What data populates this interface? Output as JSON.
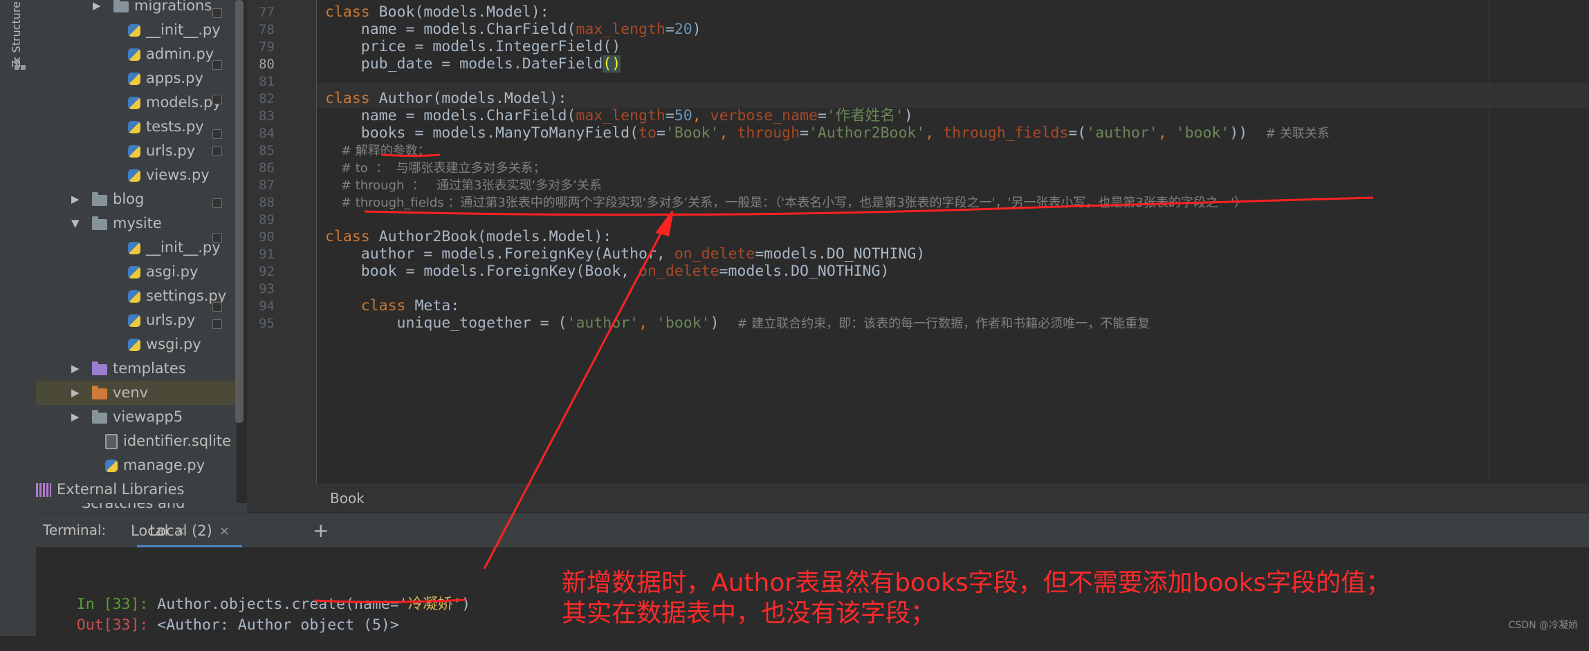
{
  "tool_strip": {
    "structure_label": "Z: Structure"
  },
  "project_tree": {
    "items": [
      {
        "label": "migrations",
        "type": "folder"
      },
      {
        "label": "__init__.py",
        "type": "py"
      },
      {
        "label": "admin.py",
        "type": "py"
      },
      {
        "label": "apps.py",
        "type": "py"
      },
      {
        "label": "models.py",
        "type": "py"
      },
      {
        "label": "tests.py",
        "type": "py"
      },
      {
        "label": "urls.py",
        "type": "py"
      },
      {
        "label": "views.py",
        "type": "py"
      },
      {
        "label": "blog",
        "type": "folder"
      },
      {
        "label": "mysite",
        "type": "folder"
      },
      {
        "label": "__init__.py",
        "type": "py"
      },
      {
        "label": "asgi.py",
        "type": "py"
      },
      {
        "label": "settings.py",
        "type": "py"
      },
      {
        "label": "urls.py",
        "type": "py"
      },
      {
        "label": "wsgi.py",
        "type": "py"
      },
      {
        "label": "templates",
        "type": "folder-purple"
      },
      {
        "label": "venv",
        "type": "folder-orange"
      },
      {
        "label": "viewapp5",
        "type": "folder"
      },
      {
        "label": "identifier.sqlite",
        "type": "file"
      },
      {
        "label": "manage.py",
        "type": "py"
      },
      {
        "label": "External Libraries",
        "type": "lib"
      }
    ],
    "scratches_label": "Scratches and Consoles"
  },
  "editor": {
    "line_numbers": [
      "77",
      "78",
      "79",
      "80",
      "81",
      "82",
      "83",
      "84",
      "85",
      "86",
      "87",
      "88",
      "89",
      "90",
      "91",
      "92",
      "93",
      "94",
      "95"
    ],
    "current_line": "80",
    "code": {
      "l77": [
        "class",
        " Book(models.Model):"
      ],
      "l78": [
        "    name = models.CharField(",
        "max_length",
        "=",
        "20",
        ")"
      ],
      "l79": [
        "    price = models.IntegerField()"
      ],
      "l80": [
        "    pub_date = models.DateField",
        "()"
      ],
      "l82": [
        "class",
        " Author(models.Model):"
      ],
      "l83": [
        "    name = models.CharField(",
        "max_length",
        "=",
        "50",
        ", ",
        "verbose_name",
        "=",
        "'作者姓名'",
        ")"
      ],
      "l84": [
        "    books = models.ManyToManyField(",
        "to",
        "=",
        "'Book'",
        ", ",
        "through",
        "=",
        "'Author2Book'",
        ", ",
        "through_fields",
        "=(",
        "'author'",
        ", ",
        "'book'",
        "))  ",
        "# 关联关系"
      ],
      "l85": [
        "    # 解释的参数："
      ],
      "l86": [
        "    # to  ：  与哪张表建立多对多关系；"
      ],
      "l87": [
        "    # through  ：   通过第3张表实现‘多对多’关系"
      ],
      "l88": [
        "    # through_fields ：通过第3张表中的哪两个字段实现‘多对多’关系，一般是：（'本表名小写，也是第3张表的字段之一'，'另一张表小写，也是第3张表的字段之一'）"
      ],
      "l90": [
        "class",
        " Author2Book(models.Model):"
      ],
      "l91": [
        "    author = models.ForeignKey(Author, ",
        "on_delete",
        "=models.DO_NOTHING)"
      ],
      "l92": [
        "    book = models.ForeignKey(Book, ",
        "on_delete",
        "=models.DO_NOTHING)"
      ],
      "l94": [
        "    ",
        "class",
        " Meta:"
      ],
      "l95": [
        "        unique_together = (",
        "'author'",
        ", ",
        "'book'",
        ")  ",
        "# 建立联合约束，即：该表的每一行数据，作者和书籍必须唯一，不能重复"
      ]
    }
  },
  "breadcrumb": "Book",
  "terminal": {
    "label": "Terminal:",
    "tabs": [
      {
        "label": "Local",
        "active": false
      },
      {
        "label": "Local (2)",
        "active": true
      }
    ],
    "add": "+",
    "in_prompt": "In [33]: ",
    "in_text_1": "Author.objects.create(name=",
    "in_str": "'冷凝娇'",
    "in_text_2": ")",
    "out_prompt": "Out[33]: ",
    "out_text": "<Author: Author object (5)>"
  },
  "annotation": {
    "line1": "新增数据时，Author表虽然有books字段，但不需要添加books字段的值；",
    "line2": "其实在数据表中，也没有该字段；",
    "color": "#ff2a2a"
  },
  "watermark": "CSDN @冷凝娇"
}
